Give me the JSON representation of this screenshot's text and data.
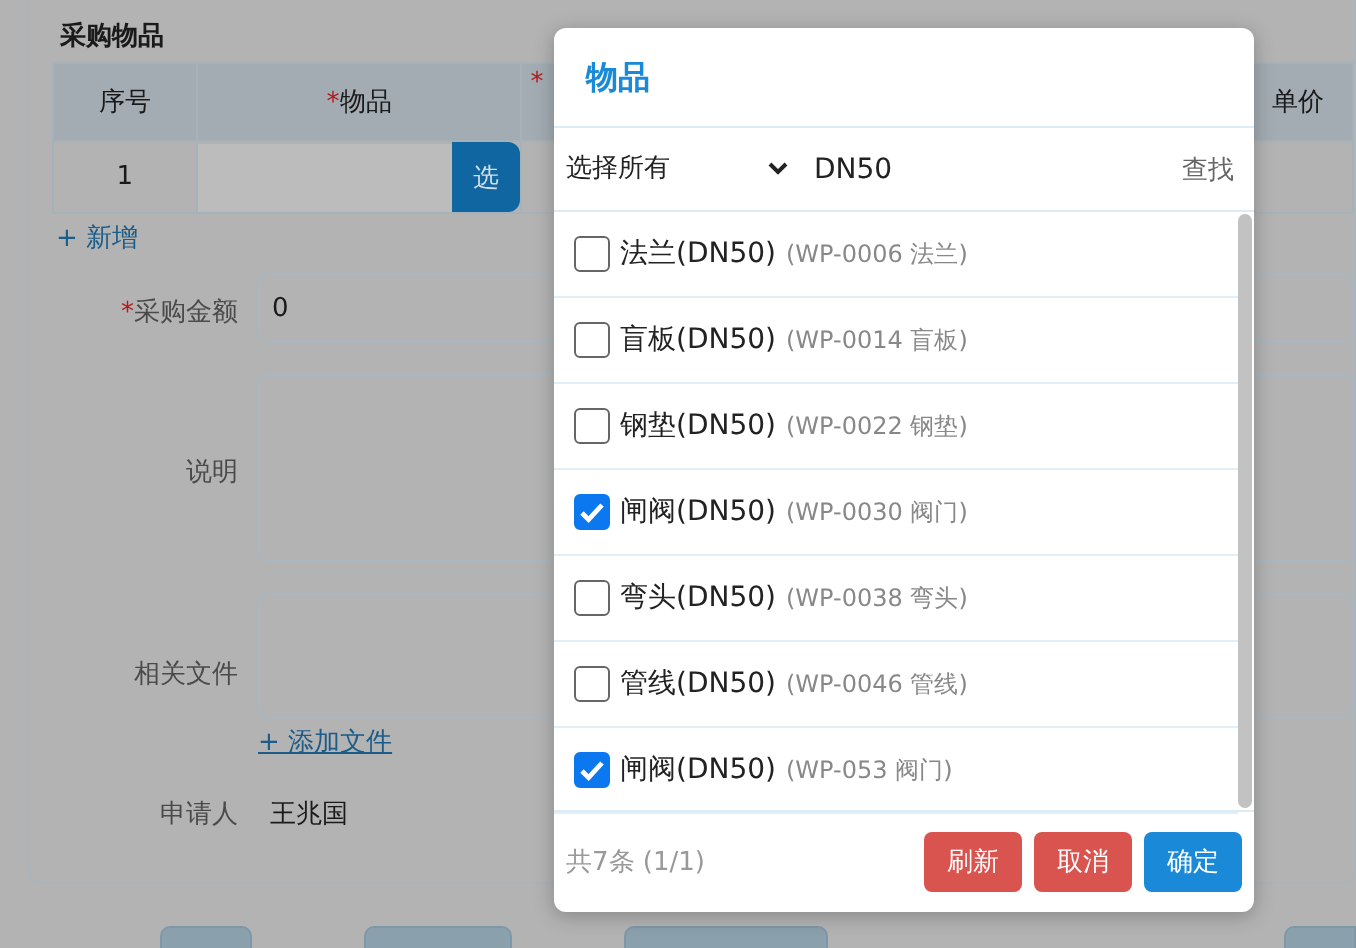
{
  "page": {
    "section_title": "采购物品",
    "table": {
      "columns": [
        {
          "label": "序号"
        },
        {
          "mark": "*",
          "label": "物品"
        },
        {
          "mark": "*"
        },
        {
          "label": "单价"
        }
      ],
      "rows": [
        {
          "index": "1",
          "pick_button": "选"
        }
      ]
    },
    "add_row_link": "+ 新增",
    "fields": [
      {
        "kind": "input",
        "mark": "*",
        "label": "采购金额",
        "value": "0"
      },
      {
        "kind": "textarea",
        "label": "说明"
      },
      {
        "kind": "files",
        "label": "相关文件",
        "link": "+ 添加文件"
      },
      {
        "kind": "text",
        "label": "申请人",
        "value": "王兆国"
      }
    ]
  },
  "dialog": {
    "title": "物品",
    "filter": {
      "select": "选择所有",
      "query": "DN50",
      "search_button": "查找"
    },
    "items": [
      {
        "name": "法兰(DN50)",
        "detail": "(WP-0006 法兰)",
        "checked": false
      },
      {
        "name": "盲板(DN50)",
        "detail": "(WP-0014 盲板)",
        "checked": false
      },
      {
        "name": "钢垫(DN50)",
        "detail": "(WP-0022 钢垫)",
        "checked": false
      },
      {
        "name": "闸阀(DN50)",
        "detail": "(WP-0030 阀门)",
        "checked": true
      },
      {
        "name": "弯头(DN50)",
        "detail": "(WP-0038 弯头)",
        "checked": false
      },
      {
        "name": "管线(DN50)",
        "detail": "(WP-0046 管线)",
        "checked": false
      },
      {
        "name": "闸阀(DN50)",
        "detail": "(WP-053 阀门)",
        "checked": true
      }
    ],
    "count": "共7条 (1/1)",
    "buttons": [
      {
        "label": "刷新",
        "kind": "danger"
      },
      {
        "label": "取消",
        "kind": "danger"
      },
      {
        "label": "确定",
        "kind": "primary"
      }
    ]
  }
}
